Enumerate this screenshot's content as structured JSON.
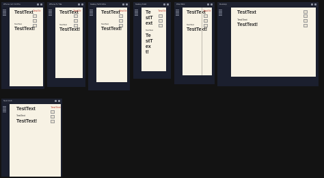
{
  "windows": [
    {
      "title": "iPhone 12 / 13 Pro",
      "heading": "TestText",
      "body": "TestText",
      "heading2": "TestText!",
      "side_label": "TestTe"
    },
    {
      "title": "iPhone 5 / SE",
      "heading": "TestText",
      "body": "TestText",
      "heading2": "TestText!",
      "side_label": "TestTe"
    },
    {
      "title": "Galaxy S20 Ultra",
      "heading": "TestText",
      "body": "TestText",
      "heading2": "TestText!",
      "side_label": "TestTe"
    },
    {
      "title": "Galaxy Fold",
      "heading": "TestText",
      "body": "TestText",
      "heading2": "TestText!",
      "side_label": "TestTe"
    },
    {
      "title": "iPad Mini",
      "heading": "TestText",
      "body": "TestText",
      "heading2": "TestText!",
      "side_label": "TestTe"
    },
    {
      "title": "Desktop",
      "heading": "TestText",
      "body": "TestText",
      "heading2": "TestText!",
      "side_label": ""
    },
    {
      "title": "Nest Hub",
      "heading": "TestText",
      "body": "TestText",
      "heading2": "TestText!",
      "side_label": "TestText"
    }
  ]
}
